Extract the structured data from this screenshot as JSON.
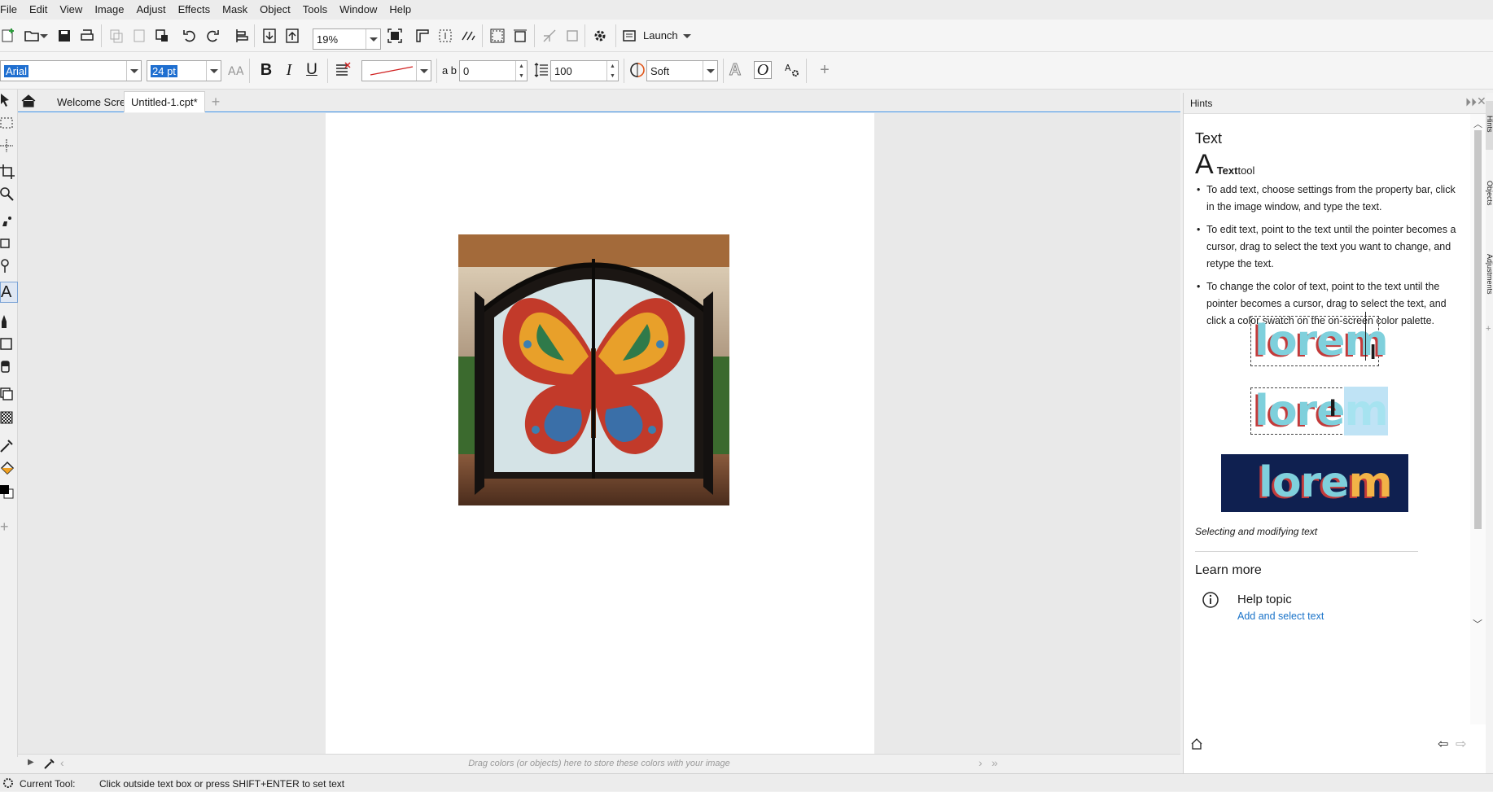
{
  "menu": [
    "File",
    "Edit",
    "View",
    "Image",
    "Adjust",
    "Effects",
    "Mask",
    "Object",
    "Tools",
    "Window",
    "Help"
  ],
  "standard_toolbar": {
    "zoom": "19%",
    "launch_label": "Launch"
  },
  "property_bar": {
    "font_name": "Arial",
    "font_size": "24 pt",
    "char_spacing": "0",
    "line_spacing": "100",
    "antialias": "Soft"
  },
  "tabs": [
    {
      "label": "Welcome Screen"
    },
    {
      "label": "Untitled-1.cpt*"
    }
  ],
  "palette_hint": "Drag colors (or objects) here to store these colors with your image",
  "status": {
    "label": "Current Tool:",
    "message": "Click outside text box or press SHIFT+ENTER to set text"
  },
  "hints": {
    "panel_title": "Hints",
    "heading": "Text",
    "tool_name_bold": "Text",
    "tool_name_rest": " tool",
    "tips": [
      "To add text, choose settings from the property bar, click in the image window, and type the text.",
      "To edit text, point to the text until the pointer becomes a cursor, drag to select the text you want to change, and retype the text.",
      "To change the color of text, point to the text until the pointer becomes a cursor, drag to select the text, and click a color swatch on the on-screen color palette."
    ],
    "sample_word_1": "lorem",
    "sample_word_2a": "lore",
    "sample_word_2b": "m",
    "sample_word_3a": "lore",
    "sample_word_3b": "m",
    "caption": "Selecting and modifying text",
    "learn_more": "Learn more",
    "help_topic": "Help topic",
    "help_link": "Add and select text"
  },
  "dock_tabs": [
    "Hints",
    "Objects",
    "Adjustments"
  ],
  "colors": {
    "accent": "#1f6fd0",
    "link": "#1a73c9",
    "lorem_fill": "#7fd0dc",
    "lorem_shadow": "#c23b3b",
    "lorem_bg": "#0f2050",
    "lorem_highlight": "#f2b347"
  }
}
